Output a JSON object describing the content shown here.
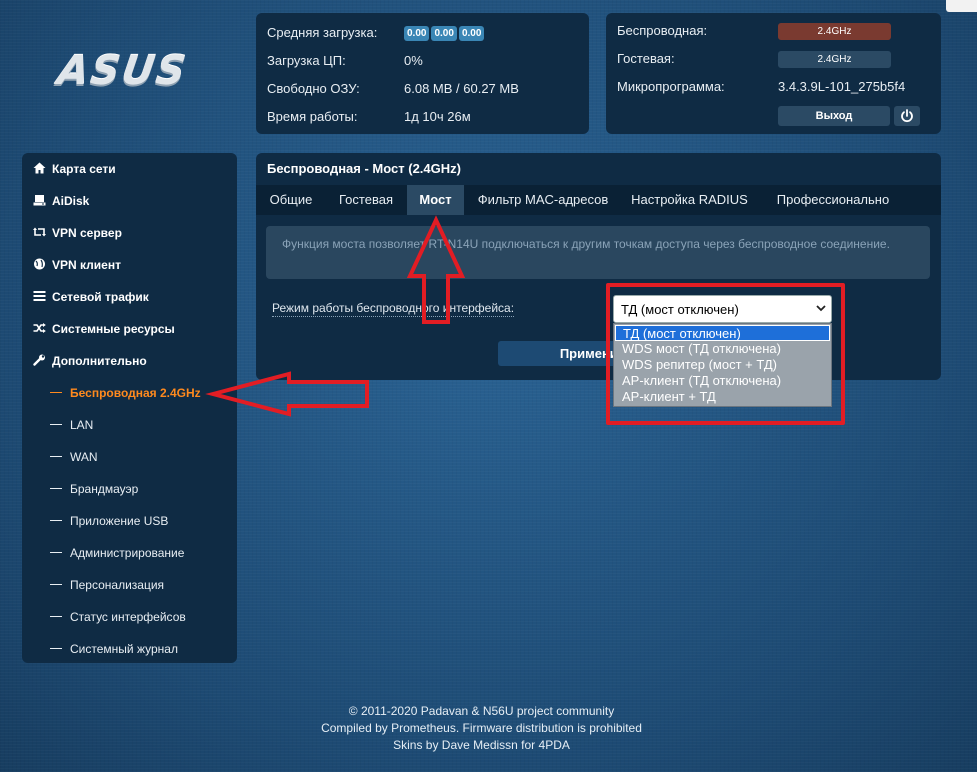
{
  "logo": {
    "text": "ASUS"
  },
  "status": {
    "avg_load_label": "Средняя загрузка:",
    "load_values": [
      "0.00",
      "0.00",
      "0.00"
    ],
    "cpu_label": "Загрузка ЦП:",
    "cpu_value": "0%",
    "ram_label": "Свободно ОЗУ:",
    "ram_value": "6.08 MB / 60.27 MB",
    "uptime_label": "Время работы:",
    "uptime_value": "1д 10ч 26м",
    "wireless_label": "Беспроводная:",
    "wireless_value": "2.4GHz",
    "wireless_color": "#7a3a30",
    "guest_label": "Гостевая:",
    "guest_value": "2.4GHz",
    "guest_color": "#2b4a64",
    "firmware_label": "Микропрограмма:",
    "firmware_value": "3.4.3.9L-101_275b5f4",
    "logout_label": "Выход",
    "power_icon": "power-icon"
  },
  "sidebar": {
    "items": [
      {
        "label": "Карта сети",
        "icon": "home-icon"
      },
      {
        "label": "AiDisk",
        "icon": "disk-icon"
      },
      {
        "label": "VPN сервер",
        "icon": "retweet-icon"
      },
      {
        "label": "VPN клиент",
        "icon": "globe-icon"
      },
      {
        "label": "Сетевой трафик",
        "icon": "list-icon"
      },
      {
        "label": "Системные ресурсы",
        "icon": "shuffle-icon"
      },
      {
        "label": "Дополнительно",
        "icon": "wrench-icon"
      }
    ],
    "subitems": [
      "Беспроводная 2.4GHz",
      "LAN",
      "WAN",
      "Брандмауэр",
      "Приложение USB",
      "Администрирование",
      "Персонализация",
      "Статус интерфейсов",
      "Системный журнал"
    ],
    "active_subitem": "Беспроводная 2.4GHz",
    "active_color": "#ff8a1e"
  },
  "main": {
    "title": "Беспроводная - Мост (2.4GHz)",
    "tabs": [
      "Общие",
      "Гостевая",
      "Мост",
      "Фильтр MAC-адресов",
      "Настройка RADIUS",
      "Профессионально"
    ],
    "active_tab": "Мост",
    "info": "Функция моста позволяет RT-N14U подключаться к другим точкам доступа через беспроводное соединение.",
    "mode_label": "Режим работы беспроводного интерфейса:",
    "apply_label": "Применить"
  },
  "select": {
    "value": "ТД (мост отключен)",
    "options": [
      "ТД (мост отключен)",
      "WDS мост (ТД отключена)",
      "WDS репитер (мост + ТД)",
      "AP-клиент (ТД отключена)",
      "AP-клиент + ТД"
    ],
    "selected_index": 0
  },
  "annotation_color": "#e21d24",
  "footer": {
    "line1": "© 2011-2020 Padavan & N56U project community",
    "line2": "Compiled by Prometheus. Firmware distribution is prohibited",
    "line3": "Skins by Dave Medissn for 4PDA"
  }
}
